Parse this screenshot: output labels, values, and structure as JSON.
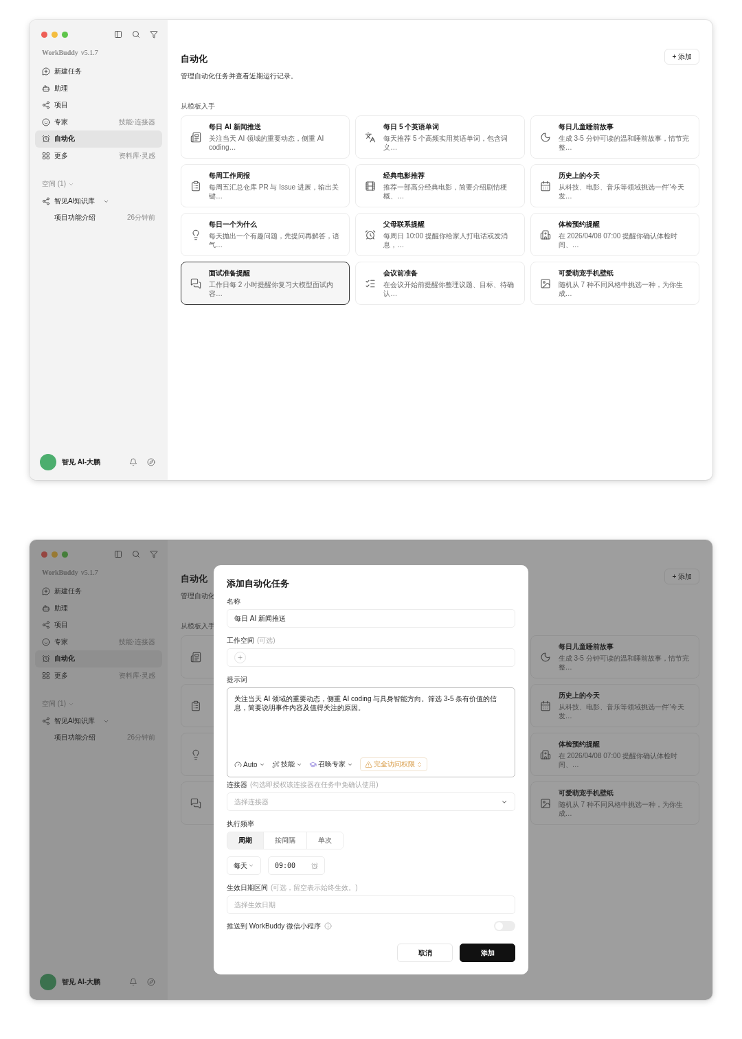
{
  "windows": [
    {
      "sidebar": {
        "brand": "WorkBuddy",
        "version": "v5.1.7",
        "nav": [
          {
            "label": "新建任务",
            "selected": false
          },
          {
            "label": "助理",
            "selected": false
          },
          {
            "label": "项目",
            "selected": false
          },
          {
            "label": "专家",
            "hint": "技能·连接器",
            "selected": false
          },
          {
            "label": "自动化",
            "selected": true
          },
          {
            "label": "更多",
            "hint": "资料库·灵感",
            "selected": false
          }
        ],
        "spaces_header": "空间 (1)",
        "spaces": [
          {
            "label": "智见AI知识库",
            "expanded": true,
            "children": [
              {
                "label": "项目功能介绍",
                "time": "26分钟前"
              }
            ]
          }
        ],
        "user": {
          "name": "智见 AI-大鹏"
        }
      },
      "main": {
        "title": "自动化",
        "add_button": "+ 添加",
        "subtitle": "管理自动化任务并查看近期运行记录。",
        "section_label": "从模板入手",
        "templates": [
          {
            "title": "每日 AI 新闻推送",
            "description": "关注当天 AI 领域的重要动态，侧重 AI coding…",
            "selected": false
          },
          {
            "title": "每日 5 个英语单词",
            "description": "每天推荐 5 个高频实用英语单词，包含词义…",
            "selected": false
          },
          {
            "title": "每日儿童睡前故事",
            "description": "生成 3-5 分钟可读的温和睡前故事，情节完整…",
            "selected": false
          },
          {
            "title": "每周工作周报",
            "description": "每周五汇总仓库 PR 与 Issue 进展，输出关键…",
            "selected": false
          },
          {
            "title": "经典电影推荐",
            "description": "推荐一部高分经典电影，简要介绍剧情梗概、…",
            "selected": false
          },
          {
            "title": "历史上的今天",
            "description": "从科技、电影、音乐等领域挑选一件\"今天发…",
            "selected": false
          },
          {
            "title": "每日一个为什么",
            "description": "每天抛出一个有趣问题，先提问再解答，语气…",
            "selected": false
          },
          {
            "title": "父母联系提醒",
            "description": "每周日 10:00 提醒你给家人打电话或发消息，…",
            "selected": false
          },
          {
            "title": "体检预约提醒",
            "description": "在 2026/04/08 07:00 提醒你确认体检时间、…",
            "selected": false
          },
          {
            "title": "面试准备提醒",
            "description": "工作日每 2 小时提醒你复习大模型面试内容…",
            "selected": true
          },
          {
            "title": "会议前准备",
            "description": "在会议开始前提醒你整理议题、目标、待确认…",
            "selected": false
          },
          {
            "title": "可爱萌宠手机壁纸",
            "description": "随机从 7 种不同风格中挑选一种，为你生成…",
            "selected": false
          }
        ]
      }
    },
    {
      "sidebar": {
        "brand": "WorkBuddy",
        "version": "v5.1.7",
        "nav": [
          {
            "label": "新建任务",
            "selected": false
          },
          {
            "label": "助理",
            "selected": false
          },
          {
            "label": "项目",
            "selected": false
          },
          {
            "label": "专家",
            "hint": "技能·连接器",
            "selected": false
          },
          {
            "label": "自动化",
            "selected": true
          },
          {
            "label": "更多",
            "hint": "资料库·灵感",
            "selected": false
          }
        ],
        "spaces_header": "空间 (1)",
        "spaces": [
          {
            "label": "智见AI知识库",
            "expanded": true,
            "children": [
              {
                "label": "项目功能介绍",
                "time": "26分钟前"
              }
            ]
          }
        ],
        "user": {
          "name": "智见 AI-大鹏"
        }
      },
      "main": {
        "title": "自动化",
        "add_button": "+ 添加",
        "subtitle": "管理自动化",
        "section_label": "从模板入手",
        "template_rows": [
          {
            "left": {
              "selected": false
            },
            "right": {
              "title": "每日儿童睡前故事",
              "description": "生成 3-5 分钟可读的温和睡前故事，情节完整…",
              "selected": false
            }
          },
          {
            "left": {
              "selected": false
            },
            "right": {
              "title": "历史上的今天",
              "description": "从科技、电影、音乐等领域挑选一件\"今天发…",
              "selected": false
            }
          },
          {
            "left": {
              "selected": false
            },
            "right": {
              "title": "体检预约提醒",
              "description": "在 2026/04/08 07:00 提醒你确认体检时间、…",
              "selected": false
            }
          },
          {
            "left": {
              "selected": false
            },
            "right": {
              "title": "可爱萌宠手机壁纸",
              "description": "随机从 7 种不同风格中挑选一种，为你生成…",
              "selected": false
            }
          }
        ]
      },
      "dialog": {
        "title": "添加自动化任务",
        "name_field": {
          "label": "名称",
          "value": "每日 AI 新闻推送"
        },
        "workspace_field": {
          "label": "工作空间",
          "hint": "(可选)"
        },
        "prompt_field": {
          "label": "提示词",
          "value": "关注当天 AI 领域的重要动态，侧重 AI coding 与具身智能方向。筛选 3-5 条有价值的信息，简要说明事件内容及值得关注的原因。",
          "tools": [
            {
              "kind": "model",
              "label": "Auto"
            },
            {
              "kind": "skills",
              "label": "技能"
            },
            {
              "kind": "experts",
              "label": "召唤专家"
            },
            {
              "kind": "warning",
              "label": "完全访问权限"
            }
          ]
        },
        "connector_field": {
          "label": "连接器",
          "hint": "(勾选即授权该连接器在任务中免确认使用)",
          "placeholder": "选择连接器"
        },
        "frequency": {
          "label": "执行频率",
          "options": [
            {
              "label": "周期",
              "selected": true
            },
            {
              "label": "按间隔",
              "selected": false
            },
            {
              "label": "单次",
              "selected": false
            }
          ],
          "period": "每天",
          "time": "09:00"
        },
        "date_range": {
          "label": "生效日期区间",
          "hint": "(可选，留空表示始终生效。)",
          "placeholder": "选择生效日期"
        },
        "push_toggle": {
          "label": "推送到 WorkBuddy 微信小程序",
          "on": false
        },
        "buttons": [
          {
            "kind": "secondary",
            "label": "取消"
          },
          {
            "kind": "primary",
            "label": "添加"
          }
        ]
      }
    }
  ]
}
